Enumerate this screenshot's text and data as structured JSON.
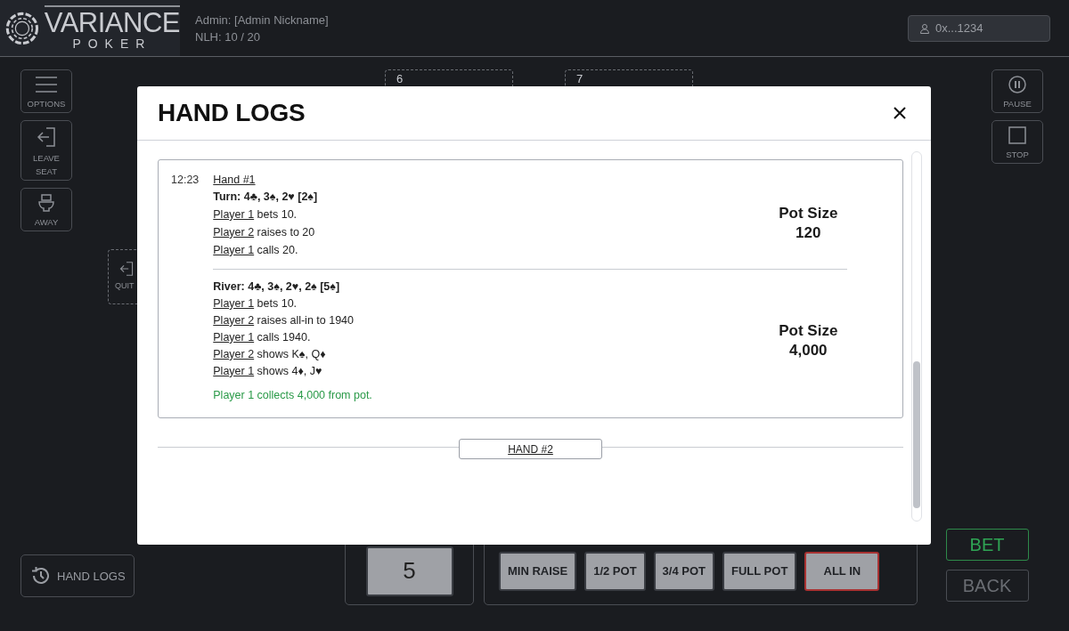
{
  "header": {
    "logo": {
      "word": "VARIANCE",
      "sub": "POKER"
    },
    "admin": "Admin: [Admin Nickname]",
    "stakes": "NLH: 10 / 20",
    "wallet": "0x...1234"
  },
  "left_controls": [
    {
      "kind": "menu",
      "label": "OPTIONS"
    },
    {
      "kind": "leave",
      "label": "LEAVE SEAT"
    },
    {
      "kind": "away",
      "label": "AWAY"
    }
  ],
  "right_controls": [
    {
      "kind": "pause",
      "label": "PAUSE"
    },
    {
      "kind": "stop",
      "label": "STOP"
    }
  ],
  "seats": [
    {
      "number": "6"
    },
    {
      "number": "7"
    }
  ],
  "quit": {
    "label": "QUIT"
  },
  "hand_logs_button": {
    "label": "HAND LOGS"
  },
  "bet_panel": {
    "amount": "5",
    "presets": [
      {
        "label": "MIN RAISE",
        "kind": "preset"
      },
      {
        "label": "1/2 POT",
        "kind": "preset"
      },
      {
        "label": "3/4 POT",
        "kind": "preset"
      },
      {
        "label": "FULL POT",
        "kind": "preset"
      },
      {
        "label": "ALL IN",
        "kind": "all_in"
      }
    ],
    "actions": [
      {
        "label": "BET",
        "kind": "primary"
      },
      {
        "label": "BACK",
        "kind": "secondary"
      }
    ]
  },
  "modal": {
    "title": "HAND LOGS",
    "hands": [
      {
        "time": "12:23",
        "title": "Hand #1",
        "streets": [
          {
            "heading": "Turn: 4♣, 3♠, 2♥ [2♠]",
            "pot_label": "Pot Size",
            "pot": "120",
            "lines": [
              {
                "kind": "action",
                "player": "Player 1",
                "text": "bets 10."
              },
              {
                "kind": "action",
                "player": "Player 2",
                "text": "raises to 20"
              },
              {
                "kind": "action",
                "player": "Player 1",
                "text": "calls 20."
              }
            ]
          },
          {
            "heading": "River: 4♣, 3♠, 2♥, 2♠ [5♠]",
            "pot_label": "Pot Size",
            "pot": "4,000",
            "lines": [
              {
                "kind": "action",
                "player": "Player 1",
                "text": "bets 10."
              },
              {
                "kind": "action",
                "player": "Player 2",
                "text": "raises all-in to 1940"
              },
              {
                "kind": "action",
                "player": "Player 1",
                "text": "calls 1940."
              },
              {
                "kind": "action",
                "player": "Player 2",
                "text": "shows K♠, Q♦"
              },
              {
                "kind": "action",
                "player": "Player 1",
                "text": "shows  4♦, J♥"
              },
              {
                "kind": "result",
                "text": "Player 1 collects 4,000 from pot."
              }
            ]
          }
        ]
      }
    ],
    "next_hand": "HAND #2"
  }
}
